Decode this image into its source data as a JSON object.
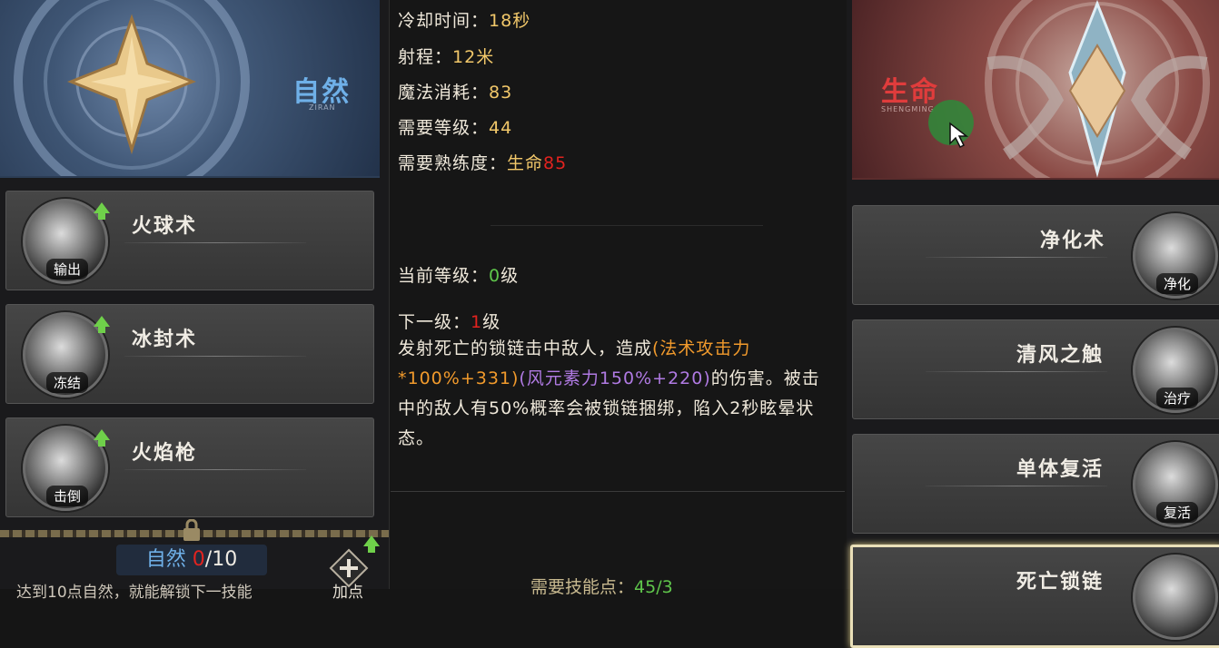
{
  "left": {
    "school": {
      "name": "自然",
      "sub": "ZIRAN"
    },
    "skills": [
      {
        "name": "火球术",
        "tag": "输出"
      },
      {
        "name": "冰封术",
        "tag": "冻结"
      },
      {
        "name": "火焰枪",
        "tag": "击倒"
      }
    ],
    "footer": {
      "school": "自然",
      "current": "0",
      "max": "/10",
      "unlock_text": "达到10点自然，就能解锁下一技能",
      "add_label": "加点"
    }
  },
  "middle": {
    "cooldown_label": "冷却时间：",
    "cooldown_value": "18秒",
    "range_label": "射程：",
    "range_value": "12米",
    "mana_label": "魔法消耗：",
    "mana_value": "83",
    "level_req_label": "需要等级：",
    "level_req_value": "44",
    "mastery_label": "需要熟练度：",
    "mastery_school": "生命",
    "mastery_value": "85",
    "current_level_label": "当前等级：",
    "current_level_value": "0",
    "current_level_unit": "级",
    "next_level_label": "下一级：",
    "next_level_value": "1",
    "next_level_unit": "级",
    "desc_a": "发射死亡的锁链击中敌人，造成",
    "desc_b": "(法术攻击力*100%+331)",
    "desc_c": "(风元素力150%+220)",
    "desc_d": "的伤害。被击中的敌人有50%概率会被锁链捆绑，陷入2秒眩晕状态。",
    "points_label": "需要技能点：",
    "points_value": "45/3"
  },
  "right": {
    "school": {
      "name": "生命",
      "sub": "SHENGMING"
    },
    "skills": [
      {
        "name": "净化术",
        "tag": "净化"
      },
      {
        "name": "清风之触",
        "tag": "治疗"
      },
      {
        "name": "单体复活",
        "tag": "复活"
      },
      {
        "name": "死亡锁链",
        "tag": ""
      }
    ]
  },
  "colors": {
    "upgrade": "#6fd04a",
    "value_gold": "#f2c86a",
    "value_red": "#e2231f",
    "value_green": "#5fc64b",
    "formula_orange": "#f19a2c",
    "formula_purple": "#b07ae3"
  }
}
